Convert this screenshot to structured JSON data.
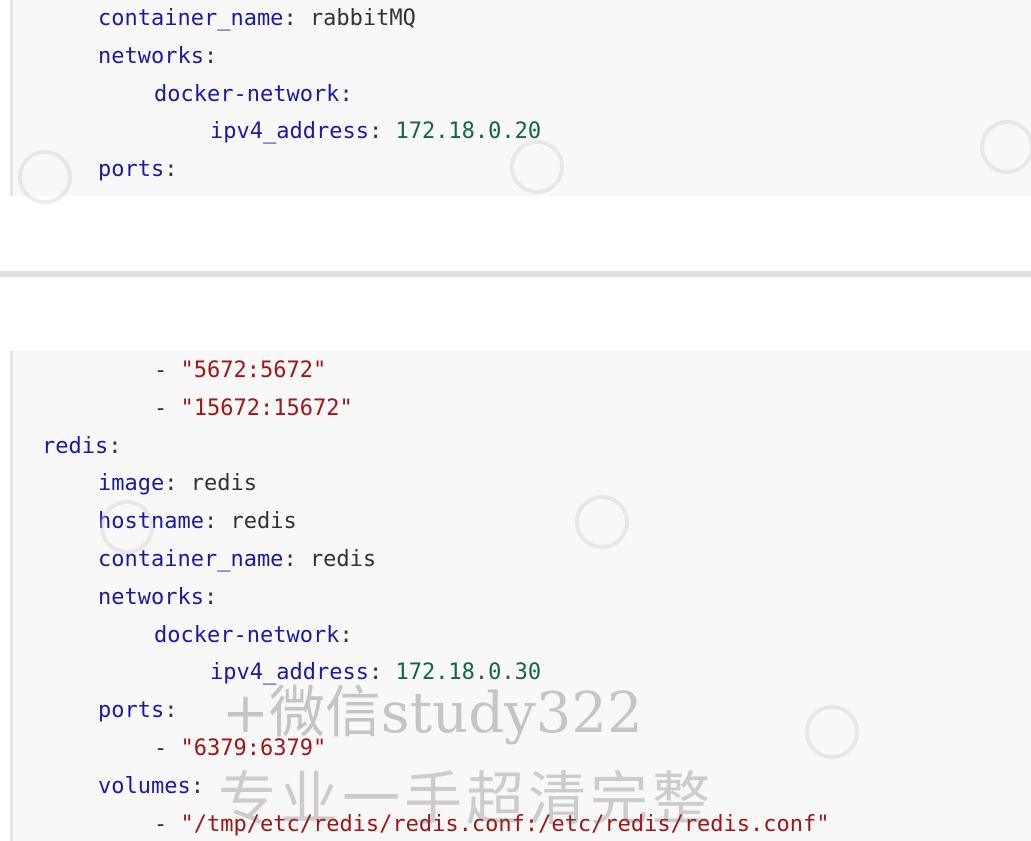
{
  "block1": {
    "lines": [
      {
        "indent": 2,
        "key": "container_name",
        "punct": ": ",
        "value": "rabbitMQ",
        "type": "plain"
      },
      {
        "indent": 2,
        "key": "networks",
        "punct": ":",
        "value": "",
        "type": "plain"
      },
      {
        "indent": 3,
        "key": "docker-network",
        "punct": ":",
        "value": "",
        "type": "plain"
      },
      {
        "indent": 4,
        "key": "ipv4_address",
        "punct": ": ",
        "value": "172.18.0.20",
        "type": "number"
      },
      {
        "indent": 2,
        "key": "ports",
        "punct": ":",
        "value": "",
        "type": "plain"
      }
    ]
  },
  "block2": {
    "lines": [
      {
        "indent": 3,
        "key": "",
        "punct": "- ",
        "value": "\"5672:5672\"",
        "type": "string"
      },
      {
        "indent": 3,
        "key": "",
        "punct": "- ",
        "value": "\"15672:15672\"",
        "type": "string"
      },
      {
        "indent": 1,
        "key": "redis",
        "punct": ":",
        "value": "",
        "type": "plain"
      },
      {
        "indent": 2,
        "key": "image",
        "punct": ": ",
        "value": "redis",
        "type": "plain"
      },
      {
        "indent": 2,
        "key": "hostname",
        "punct": ": ",
        "value": "redis",
        "type": "plain"
      },
      {
        "indent": 2,
        "key": "container_name",
        "punct": ": ",
        "value": "redis",
        "type": "plain"
      },
      {
        "indent": 2,
        "key": "networks",
        "punct": ":",
        "value": "",
        "type": "plain"
      },
      {
        "indent": 3,
        "key": "docker-network",
        "punct": ":",
        "value": "",
        "type": "plain"
      },
      {
        "indent": 4,
        "key": "ipv4_address",
        "punct": ": ",
        "value": "172.18.0.30",
        "type": "number"
      },
      {
        "indent": 2,
        "key": "ports",
        "punct": ":",
        "value": "",
        "type": "plain"
      },
      {
        "indent": 3,
        "key": "",
        "punct": "- ",
        "value": "\"6379:6379\"",
        "type": "string"
      },
      {
        "indent": 2,
        "key": "volumes",
        "punct": ":",
        "value": "",
        "type": "plain"
      },
      {
        "indent": 3,
        "key": "",
        "punct": "- ",
        "value": "\"/tmp/etc/redis/redis.conf:/etc/redis/redis.conf\"",
        "type": "string"
      }
    ]
  },
  "watermark": {
    "line1": "+微信study322",
    "line2": "专业一手超清完整"
  },
  "colors": {
    "key": "#1a1aa6",
    "string": "#a31515",
    "number": "#116644",
    "code_background": "#f8f8f8"
  }
}
